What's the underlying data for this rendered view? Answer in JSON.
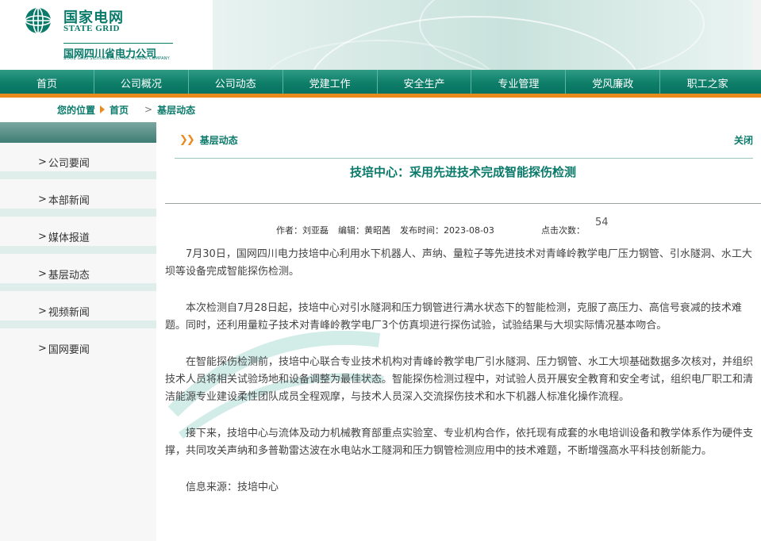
{
  "header": {
    "logo_cn": "国家电网",
    "logo_en": "STATE GRID",
    "company_cn": "国网四川省电力公司",
    "company_en": "STATE GRID SICHUAN ELECTRIC POWER COMPANY",
    "logo_icon": "state-grid-globe-icon"
  },
  "nav": {
    "items": [
      "首页",
      "公司概况",
      "公司动态",
      "党建工作",
      "安全生产",
      "专业管理",
      "党风廉政",
      "职工之家"
    ]
  },
  "breadcrumb": {
    "label": "您的位置",
    "home": "首页",
    "sep": ">",
    "current": "基层动态"
  },
  "sidebar": {
    "items": [
      "公司要闻",
      "本部新闻",
      "媒体报道",
      "基层动态",
      "视频新闻",
      "国网要闻"
    ],
    "chevron": ">"
  },
  "article": {
    "section": "基层动态",
    "close_label": "关闭",
    "title": "技培中心：采用先进技术完成智能探伤检测",
    "author": "作者：刘亚磊",
    "editor": "编辑：黄昭茜",
    "published": "发布时间：2023-08-03",
    "hits_label": "点击次数：",
    "hits": "54",
    "paragraphs": [
      "7月30日，国网四川电力技培中心利用水下机器人、声纳、量粒子等先进技术对青峰岭教学电厂压力钢管、引水隧洞、水工大坝等设备完成智能探伤检测。",
      "本次检测自7月28日起，技培中心对引水隧洞和压力钢管进行满水状态下的智能检测，克服了高压力、高信号衰减的技术难题。同时，还利用量粒子技术对青峰岭教学电厂3个仿真坝进行探伤试验，试验结果与大坝实际情况基本吻合。",
      "在智能探伤检测前，技培中心联合专业技术机构对青峰岭教学电厂引水隧洞、压力钢管、水工大坝基础数据多次核对，并组织技术人员将相关试验场地和设备调整为最佳状态。智能探伤检测过程中，对试验人员开展安全教育和安全考试，组织电厂职工和清洁能源专业建设柔性团队成员全程观摩，与技术人员深入交流探伤技术和水下机器人标准化操作流程。",
      "接下来，技培中心与流体及动力机械教育部重点实验室、专业机构合作，依托现有成套的水电培训设备和教学体系作为硬件支撑，共同攻关声纳和多普勒雷达波在水电站水工隧洞和压力钢管检测应用中的技术难题，不断增强高水平科技创新能力。"
    ],
    "source": "信息来源：技培中心"
  },
  "colors": {
    "brand_green": "#0a7a6a",
    "accent_orange": "#e98a1d"
  }
}
